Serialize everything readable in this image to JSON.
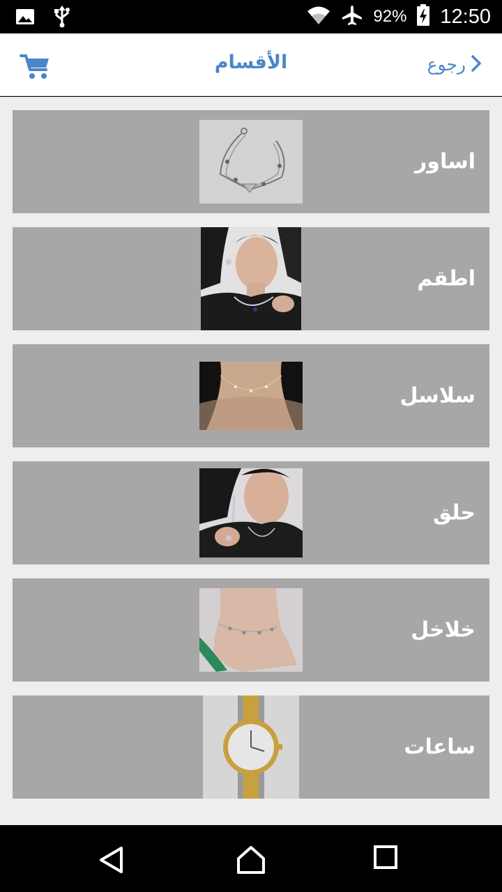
{
  "status_bar": {
    "battery": "92%",
    "time": "12:50",
    "icons": [
      "image-icon",
      "usb-icon",
      "wifi-icon",
      "airplane-icon",
      "battery-charging-icon"
    ]
  },
  "header": {
    "title": "الأقسام",
    "back_label": "رجوع",
    "accent_color": "#4a86c8"
  },
  "categories": [
    {
      "label": "اساور",
      "image": "bracelet-photo"
    },
    {
      "label": "اطقم",
      "image": "jewelry-set-photo"
    },
    {
      "label": "سلاسل",
      "image": "necklace-photo"
    },
    {
      "label": "حلق",
      "image": "earrings-photo"
    },
    {
      "label": "خلاخل",
      "image": "anklet-photo"
    },
    {
      "label": "ساعات",
      "image": "watch-photo"
    }
  ],
  "nav_bar": {
    "icons": [
      "back-triangle-icon",
      "home-icon",
      "recents-square-icon"
    ]
  }
}
